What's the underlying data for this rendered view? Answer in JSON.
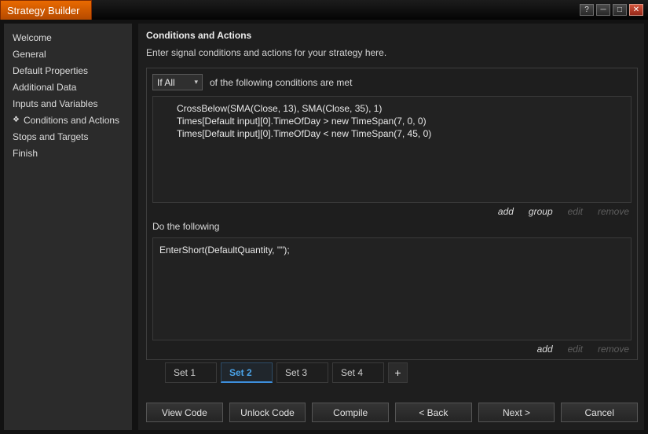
{
  "window": {
    "title": "Strategy Builder",
    "controls": [
      {
        "name": "help",
        "glyph": "?"
      },
      {
        "name": "minimize",
        "glyph": "─"
      },
      {
        "name": "maximize",
        "glyph": "□"
      },
      {
        "name": "close",
        "glyph": "✕"
      }
    ]
  },
  "icons": {
    "selected_marker": "❖",
    "chevron_down": "▾",
    "add_tab": "+"
  },
  "sidebar": {
    "items": [
      {
        "label": "Welcome"
      },
      {
        "label": "General"
      },
      {
        "label": "Default Properties"
      },
      {
        "label": "Additional Data"
      },
      {
        "label": "Inputs and Variables"
      },
      {
        "label": "Conditions and Actions",
        "selected": true
      },
      {
        "label": "Stops and Targets"
      },
      {
        "label": "Finish"
      }
    ]
  },
  "main": {
    "title": "Conditions and Actions",
    "subtitle": "Enter signal conditions and actions for your strategy here.",
    "conditions": {
      "mode_value": "If All",
      "suffix": "of the following conditions are met",
      "items": [
        "CrossBelow(SMA(Close, 13), SMA(Close, 35), 1)",
        "Times[Default input][0].TimeOfDay > new TimeSpan(7, 0, 0)",
        "Times[Default input][0].TimeOfDay < new TimeSpan(7, 45, 0)"
      ],
      "links": {
        "add": "add",
        "group": "group",
        "edit": "edit",
        "remove": "remove"
      }
    },
    "actions": {
      "label": "Do the following",
      "items": [
        "EnterShort(DefaultQuantity, \"\");"
      ],
      "links": {
        "add": "add",
        "edit": "edit",
        "remove": "remove"
      }
    },
    "tabs": [
      {
        "label": "Set 1"
      },
      {
        "label": "Set 2",
        "selected": true
      },
      {
        "label": "Set 3"
      },
      {
        "label": "Set 4"
      }
    ],
    "buttons": [
      {
        "label": "View Code"
      },
      {
        "label": "Unlock Code"
      },
      {
        "label": "Compile"
      },
      {
        "label": "< Back"
      },
      {
        "label": "Next >"
      },
      {
        "label": "Cancel"
      }
    ]
  }
}
